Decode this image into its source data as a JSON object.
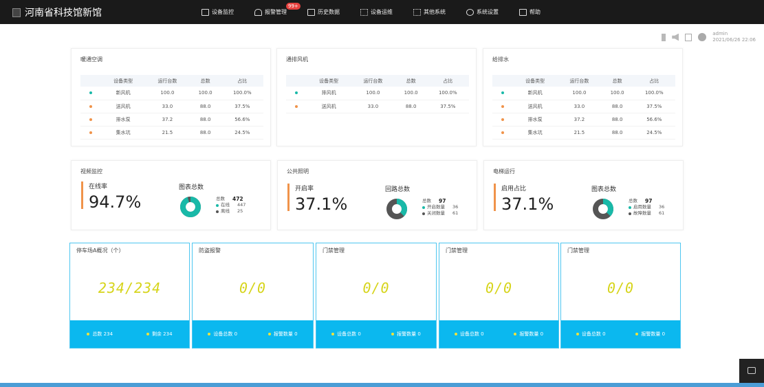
{
  "app": {
    "title": "河南省科技馆新馆"
  },
  "nav": [
    {
      "label": "设备监控",
      "icon": "monitor-icon"
    },
    {
      "label": "报警管理",
      "icon": "bell-icon",
      "badge": "99+"
    },
    {
      "label": "历史数据",
      "icon": "history-icon"
    },
    {
      "label": "设备运维",
      "icon": "grid-icon"
    },
    {
      "label": "其他系统",
      "icon": "apps-icon"
    },
    {
      "label": "系统设置",
      "icon": "gear-icon"
    },
    {
      "label": "帮助",
      "icon": "help-icon"
    }
  ],
  "user": {
    "name": "admin",
    "datetime": "2021/06/26  22:06"
  },
  "tables": [
    {
      "title": "暖通空调",
      "headers": [
        "设备类型",
        "运行台数",
        "总数",
        "占比"
      ],
      "rows": [
        {
          "color": "#19b9a8",
          "type": "新风机",
          "running": "100.0",
          "total": "100.0",
          "ratio": "100.0%"
        },
        {
          "color": "#f0934a",
          "type": "送风机",
          "running": "33.0",
          "total": "88.0",
          "ratio": "37.5%"
        },
        {
          "color": "#f0934a",
          "type": "排水泵",
          "running": "37.2",
          "total": "88.0",
          "ratio": "56.6%"
        },
        {
          "color": "#f0934a",
          "type": "集水坑",
          "running": "21.5",
          "total": "88.0",
          "ratio": "24.5%"
        }
      ]
    },
    {
      "title": "通排风机",
      "headers": [
        "设备类型",
        "运行台数",
        "总数",
        "占比"
      ],
      "rows": [
        {
          "color": "#19b9a8",
          "type": "排风机",
          "running": "100.0",
          "total": "100.0",
          "ratio": "100.0%"
        },
        {
          "color": "#f0934a",
          "type": "送风机",
          "running": "33.0",
          "total": "88.0",
          "ratio": "37.5%"
        }
      ]
    },
    {
      "title": "给排水",
      "headers": [
        "设备类型",
        "运行台数",
        "总数",
        "占比"
      ],
      "rows": [
        {
          "color": "#19b9a8",
          "type": "新风机",
          "running": "100.0",
          "total": "100.0",
          "ratio": "100.0%"
        },
        {
          "color": "#f0934a",
          "type": "送风机",
          "running": "33.0",
          "total": "88.0",
          "ratio": "37.5%"
        },
        {
          "color": "#f0934a",
          "type": "排水泵",
          "running": "37.2",
          "total": "88.0",
          "ratio": "56.6%"
        },
        {
          "color": "#f0934a",
          "type": "集水坑",
          "running": "21.5",
          "total": "88.0",
          "ratio": "24.5%"
        }
      ]
    }
  ],
  "stats": [
    {
      "title": "视频监控",
      "label": "在线率",
      "value": "94.7%",
      "chart_label": "图表总数",
      "total_label": "总数",
      "total": "472",
      "legend": [
        {
          "label": "在线",
          "value": "447",
          "color": "#19b9a8"
        },
        {
          "label": "离线",
          "value": "25",
          "color": "#555555"
        }
      ],
      "fraction": 0.947
    },
    {
      "title": "公共照明",
      "label": "开启率",
      "value": "37.1%",
      "chart_label": "回路总数",
      "total_label": "总数",
      "total": "97",
      "legend": [
        {
          "label": "开启数量",
          "value": "36",
          "color": "#19b9a8"
        },
        {
          "label": "关闭数量",
          "value": "61",
          "color": "#555555"
        }
      ],
      "fraction": 0.371
    },
    {
      "title": "电梯运行",
      "label": "启用占比",
      "value": "37.1%",
      "chart_label": "图表总数",
      "total_label": "总数",
      "total": "97",
      "legend": [
        {
          "label": "启用数量",
          "value": "36",
          "color": "#19b9a8"
        },
        {
          "label": "故障数量",
          "value": "61",
          "color": "#555555"
        }
      ],
      "fraction": 0.371
    }
  ],
  "panels": [
    {
      "title": "停车场A概况（个）",
      "value": "234/234",
      "foot": [
        {
          "label": "总数",
          "value": "234"
        },
        {
          "label": "剩余",
          "value": "234"
        }
      ]
    },
    {
      "title": "防盗报警",
      "value": "0/0",
      "foot": [
        {
          "label": "设备总数",
          "value": "0"
        },
        {
          "label": "报警数量",
          "value": "0"
        }
      ]
    },
    {
      "title": "门禁管理",
      "value": "0/0",
      "foot": [
        {
          "label": "设备总数",
          "value": "0"
        },
        {
          "label": "报警数量",
          "value": "0"
        }
      ]
    },
    {
      "title": "门禁管理",
      "value": "0/0",
      "foot": [
        {
          "label": "设备总数",
          "value": "0"
        },
        {
          "label": "报警数量",
          "value": "0"
        }
      ]
    },
    {
      "title": "门禁管理",
      "value": "0/0",
      "foot": [
        {
          "label": "设备总数",
          "value": "0"
        },
        {
          "label": "报警数量",
          "value": "0"
        }
      ]
    }
  ]
}
